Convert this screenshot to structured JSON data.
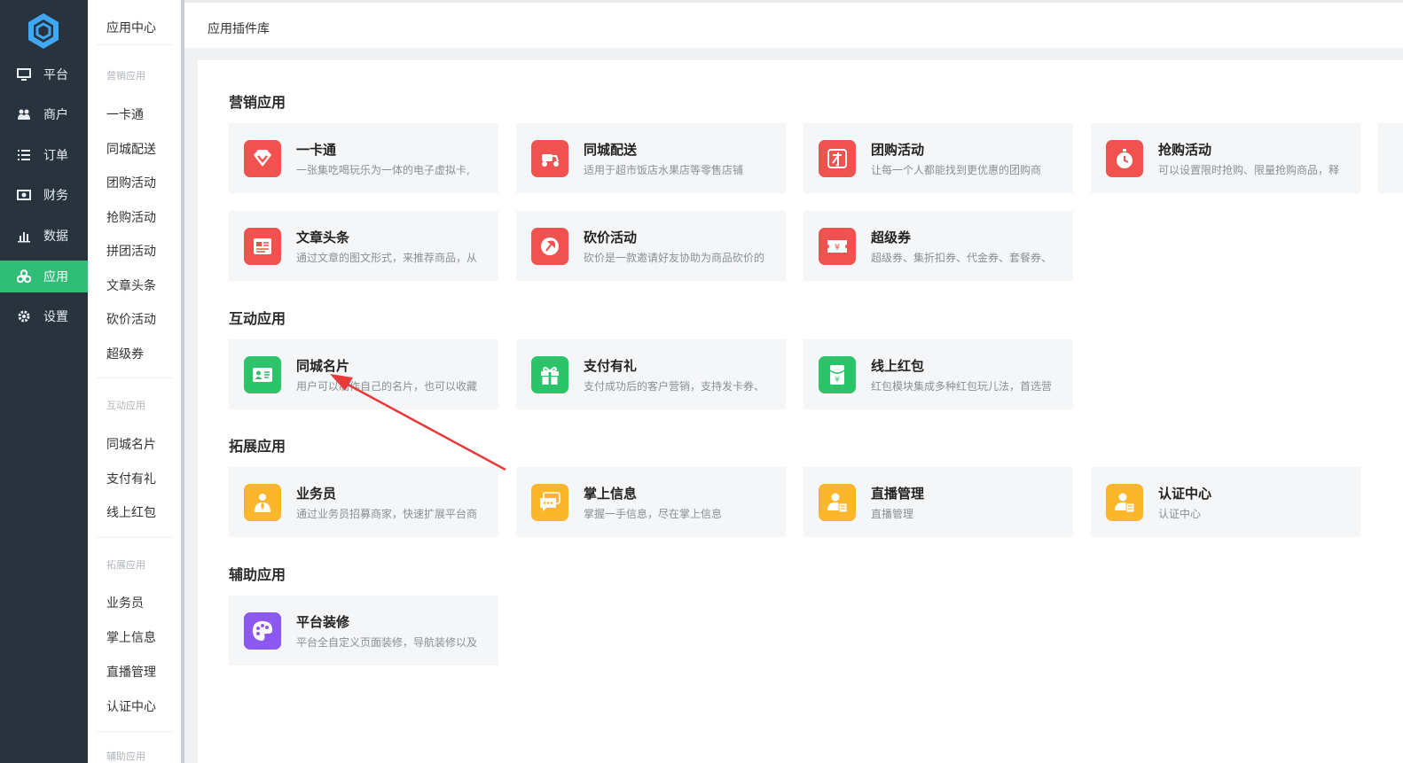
{
  "sidebar": {
    "items": [
      {
        "label": "平台",
        "icon": "monitor-icon"
      },
      {
        "label": "商户",
        "icon": "users-icon"
      },
      {
        "label": "订单",
        "icon": "list-icon"
      },
      {
        "label": "财务",
        "icon": "money-icon"
      },
      {
        "label": "数据",
        "icon": "bar-chart-icon"
      },
      {
        "label": "应用",
        "icon": "apps-icon",
        "active": true
      },
      {
        "label": "设置",
        "icon": "gear-icon"
      }
    ]
  },
  "submenu": {
    "title": "应用中心",
    "groups": [
      {
        "label": "营销应用",
        "items": [
          "一卡通",
          "同城配送",
          "团购活动",
          "抢购活动",
          "拼团活动",
          "文章头条",
          "砍价活动",
          "超级券"
        ]
      },
      {
        "label": "互动应用",
        "items": [
          "同城名片",
          "支付有礼",
          "线上红包"
        ]
      },
      {
        "label": "拓展应用",
        "items": [
          "业务员",
          "掌上信息",
          "直播管理",
          "认证中心"
        ]
      },
      {
        "label": "辅助应用",
        "items": []
      }
    ]
  },
  "topbar": {
    "title": "应用插件库"
  },
  "sections": [
    {
      "title": "营销应用",
      "cards": [
        {
          "name": "一卡通",
          "desc": "一张集吃喝玩乐为一体的电子虚拟卡,",
          "color": "#f0524f",
          "icon": "diamond-icon"
        },
        {
          "name": "同城配送",
          "desc": "适用于超市饭店水果店等零售店铺",
          "color": "#f0524f",
          "icon": "scooter-icon"
        },
        {
          "name": "团购活动",
          "desc": "让每一个人都能找到更优惠的团购商",
          "color": "#f0524f",
          "icon": "group-buy-icon"
        },
        {
          "name": "抢购活动",
          "desc": "可以设置限时抢购、限量抢购商品，释",
          "color": "#f0524f",
          "icon": "stopwatch-icon"
        },
        {
          "name": "文章头条",
          "desc": "通过文章的图文形式，来推荐商品，从",
          "color": "#f0524f",
          "icon": "article-icon"
        },
        {
          "name": "砍价活动",
          "desc": "砍价是一款邀请好友协助为商品砍价的",
          "color": "#f0524f",
          "icon": "axe-icon"
        },
        {
          "name": "超级券",
          "desc": "超级券、集折扣券、代金券、套餐券、",
          "color": "#f0524f",
          "icon": "ticket-icon"
        }
      ]
    },
    {
      "title": "互动应用",
      "cards": [
        {
          "name": "同城名片",
          "desc": "用户可以制作自己的名片，也可以收藏",
          "color": "#2bc46a",
          "icon": "id-card-icon"
        },
        {
          "name": "支付有礼",
          "desc": "支付成功后的客户营销，支持发卡券、",
          "color": "#2bc46a",
          "icon": "gift-icon"
        },
        {
          "name": "线上红包",
          "desc": "红包模块集成多种红包玩儿法，首选营",
          "color": "#2bc46a",
          "icon": "red-packet-icon"
        }
      ]
    },
    {
      "title": "拓展应用",
      "cards": [
        {
          "name": "业务员",
          "desc": "通过业务员招募商家，快速扩展平台商",
          "color": "#fbb62b",
          "icon": "salesman-icon"
        },
        {
          "name": "掌上信息",
          "desc": "掌握一手信息，尽在掌上信息",
          "color": "#fbb62b",
          "icon": "chat-icon"
        },
        {
          "name": "直播管理",
          "desc": "直播管理",
          "color": "#fbb62b",
          "icon": "profile-icon"
        },
        {
          "name": "认证中心",
          "desc": "认证中心",
          "color": "#fbb62b",
          "icon": "certify-icon"
        }
      ]
    },
    {
      "title": "辅助应用",
      "cards": [
        {
          "name": "平台装修",
          "desc": "平台全自定义页面装修，导航装修以及",
          "color": "#8b59f0",
          "icon": "palette-icon"
        }
      ]
    }
  ]
}
